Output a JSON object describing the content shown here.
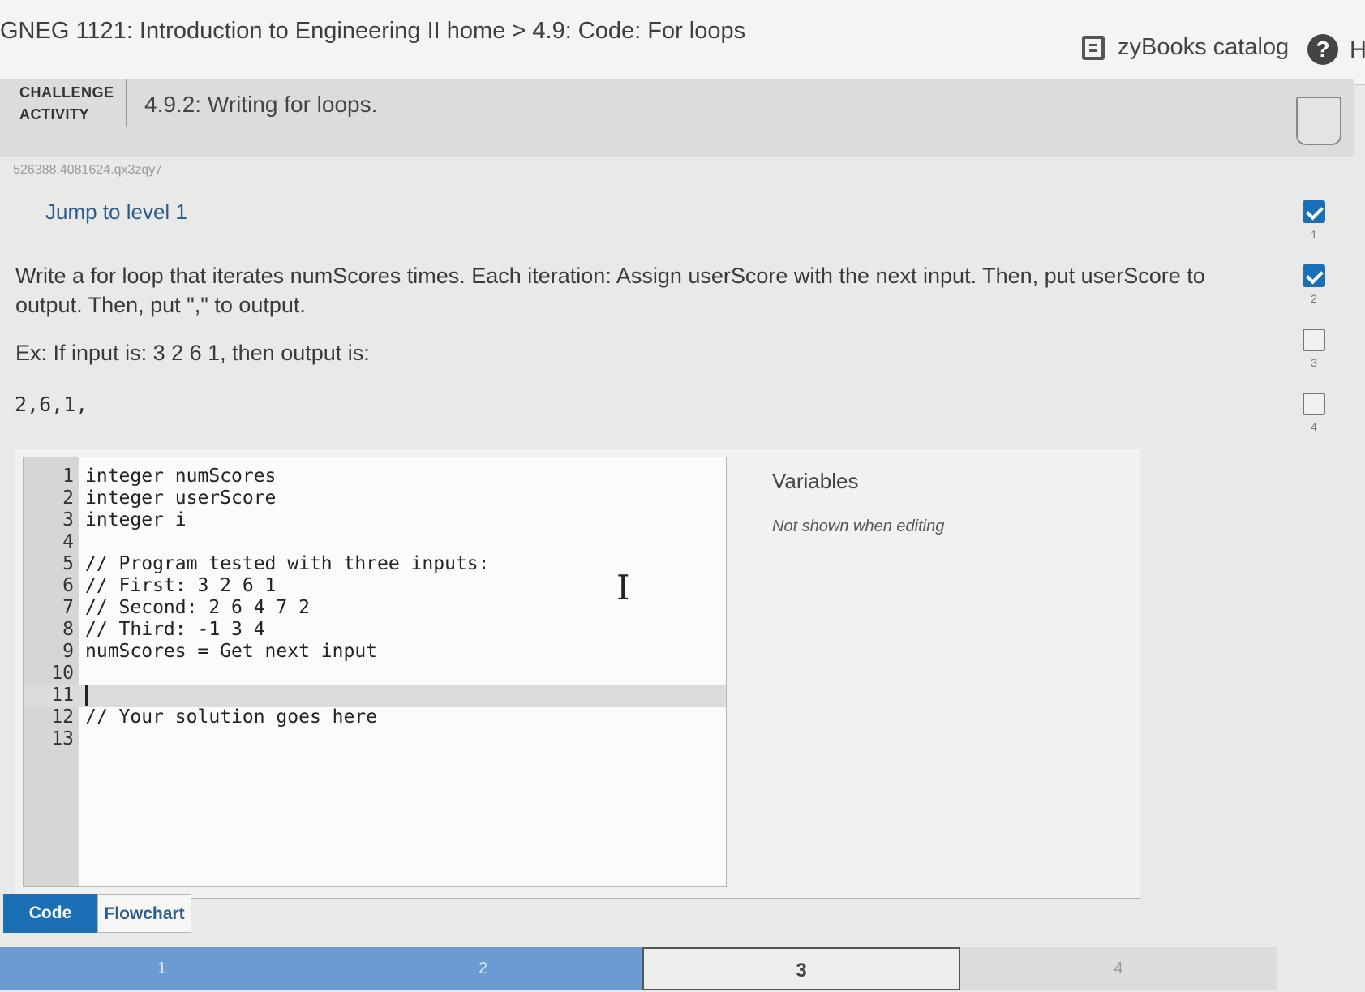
{
  "header": {
    "breadcrumb": "GNEG 1121: Introduction to Engineering II home > 4.9: Code: For loops",
    "catalog_label": "zyBooks catalog",
    "help_icon": "?",
    "help_label": "H"
  },
  "challenge": {
    "label_line1": "CHALLENGE",
    "label_line2": "ACTIVITY",
    "title": "4.9.2: Writing for loops."
  },
  "content_id": "526388.4081624.qx3zqy7",
  "jump_link": "Jump to level 1",
  "instructions": "Write a for loop that iterates numScores times. Each iteration: Assign userScore with the next input. Then, put userScore to output. Then, put \",\" to output.",
  "example": "Ex: If input is: 3 2 6 1, then output is:",
  "example_output": "2,6,1,",
  "levels": [
    {
      "number": "1",
      "completed": true
    },
    {
      "number": "2",
      "completed": true
    },
    {
      "number": "3",
      "completed": false
    },
    {
      "number": "4",
      "completed": false
    }
  ],
  "editor": {
    "lines": [
      {
        "num": "1",
        "text": "integer numScores"
      },
      {
        "num": "2",
        "text": "integer userScore"
      },
      {
        "num": "3",
        "text": "integer i"
      },
      {
        "num": "4",
        "text": ""
      },
      {
        "num": "5",
        "text": "// Program tested with three inputs:"
      },
      {
        "num": "6",
        "text": "// First: 3 2 6 1"
      },
      {
        "num": "7",
        "text": "// Second: 2 6 4 7 2"
      },
      {
        "num": "8",
        "text": "// Third: -1 3 4"
      },
      {
        "num": "9",
        "text": "numScores = Get next input"
      },
      {
        "num": "10",
        "text": ""
      },
      {
        "num": "11",
        "text": ""
      },
      {
        "num": "12",
        "text": "// Your solution goes here"
      },
      {
        "num": "13",
        "text": ""
      }
    ],
    "active_line": 11
  },
  "variables": {
    "title": "Variables",
    "note": "Not shown when editing"
  },
  "tabs": {
    "code": "Code",
    "flowchart": "Flowchart"
  },
  "progress": [
    {
      "label": "1",
      "state": "done"
    },
    {
      "label": "2",
      "state": "done"
    },
    {
      "label": "3",
      "state": "current"
    },
    {
      "label": "4",
      "state": "todo"
    }
  ],
  "colors": {
    "accent": "#1b6fb5",
    "progress_done": "#6b9bd0",
    "link": "#2f5d8a"
  }
}
